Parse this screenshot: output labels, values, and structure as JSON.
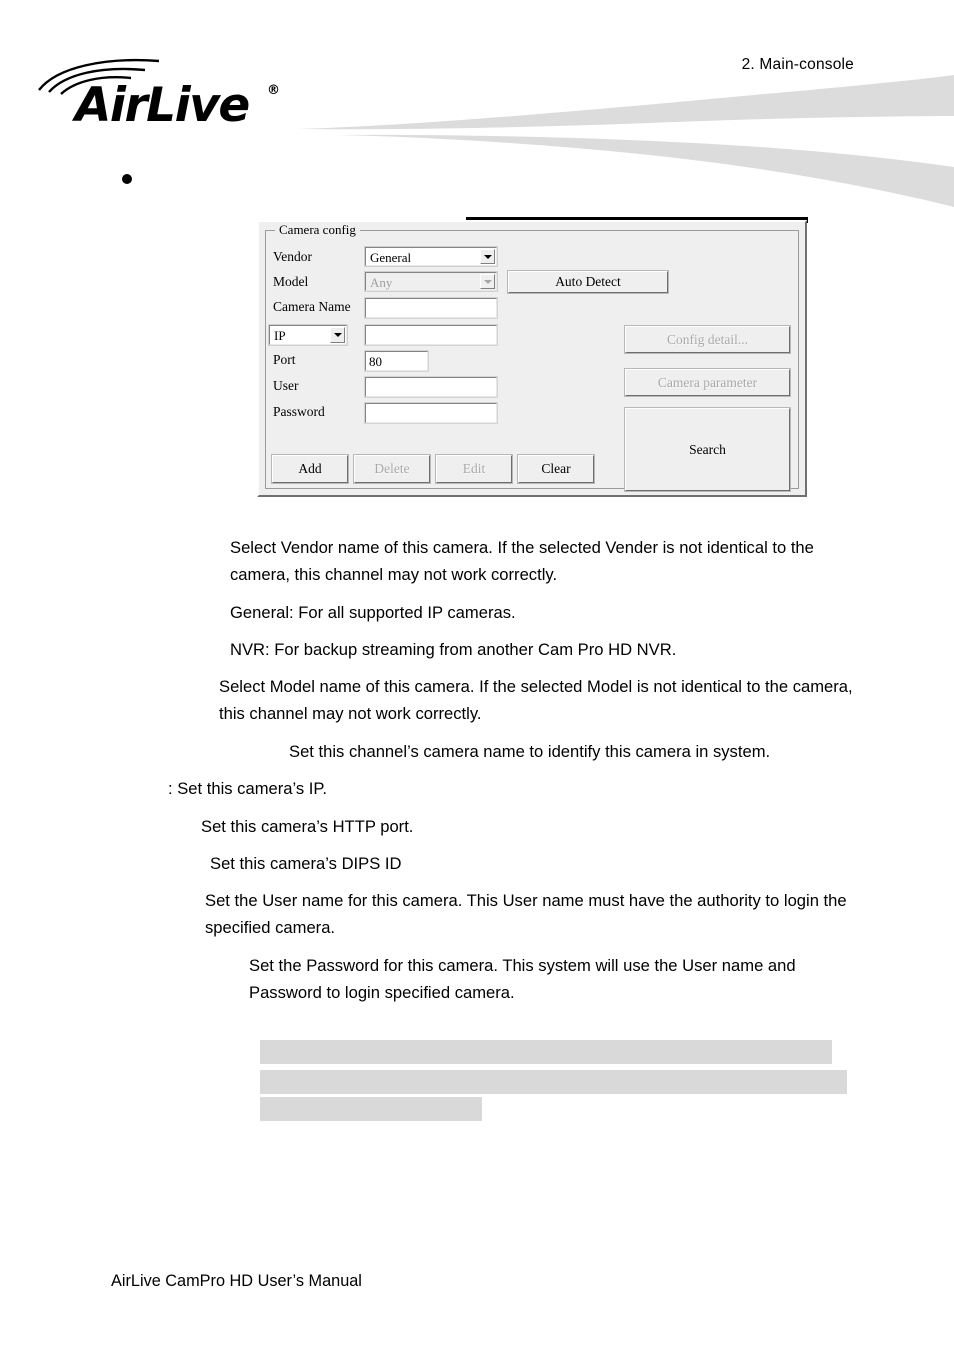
{
  "header": {
    "chapter": "2.  Main-console",
    "logo_text": "AirLive",
    "logo_registered": "®"
  },
  "dialog": {
    "group_title": "Camera config",
    "labels": {
      "vendor": "Vendor",
      "model": "Model",
      "camera_name": "Camera Name",
      "port": "Port",
      "user": "User",
      "password": "Password"
    },
    "vendor_select": {
      "value": "General",
      "options": [
        "General",
        "NVR"
      ],
      "enabled": true
    },
    "model_select": {
      "value": "Any",
      "options": [
        "Any"
      ],
      "enabled": false
    },
    "camera_name_input": {
      "value": "",
      "placeholder": ""
    },
    "address_type_select": {
      "value": "IP",
      "options": [
        "IP",
        "DIPS"
      ],
      "enabled": true
    },
    "address_input": {
      "value": "",
      "placeholder": ""
    },
    "port_input": {
      "value": "80",
      "placeholder": ""
    },
    "user_input": {
      "value": "",
      "placeholder": ""
    },
    "password_input": {
      "value": "",
      "placeholder": ""
    },
    "buttons": {
      "auto_detect": {
        "label": "Auto Detect",
        "enabled": true
      },
      "config_detail": {
        "label": "Config detail...",
        "enabled": false
      },
      "camera_parameter": {
        "label": "Camera parameter",
        "enabled": false
      },
      "search": {
        "label": "Search",
        "enabled": true
      },
      "add": {
        "label": "Add",
        "enabled": true
      },
      "delete": {
        "label": "Delete",
        "enabled": false
      },
      "edit": {
        "label": "Edit",
        "enabled": false
      },
      "clear": {
        "label": "Clear",
        "enabled": true
      }
    }
  },
  "body": {
    "p1": "Select Vendor name of this camera. If the selected Vender is not identical to the camera, this channel may not work correctly.",
    "p2": "General: For all supported IP cameras.",
    "p3": "NVR: For backup streaming from another Cam Pro HD NVR.",
    "p4": "Select Model name of this camera. If the selected Model is not identical to the camera, this channel may not work correctly.",
    "p5": "Set this channel’s camera name to identify this camera in system.",
    "p6": ": Set this camera’s IP.",
    "p7": "Set this camera’s HTTP port.",
    "p8": "Set this camera’s DIPS ID",
    "p9": "Set the User name for this camera. This User name must have the authority to login the specified camera.",
    "p10": "Set the Password for this camera. This system will use the User name and Password to login specified camera."
  },
  "redactions": {
    "bar_top": "",
    "bar_1": "",
    "bar_2": "",
    "bar_3": ""
  },
  "footer": {
    "text": "AirLive CamPro HD User’s Manual"
  },
  "colors": {
    "page_background": "#ffffff",
    "text": "#000000",
    "swoosh_gray": "#dcdcdc",
    "redaction_gray": "#d9d9d9",
    "redaction_black": "#000000",
    "dialog_face": "#efefef"
  }
}
